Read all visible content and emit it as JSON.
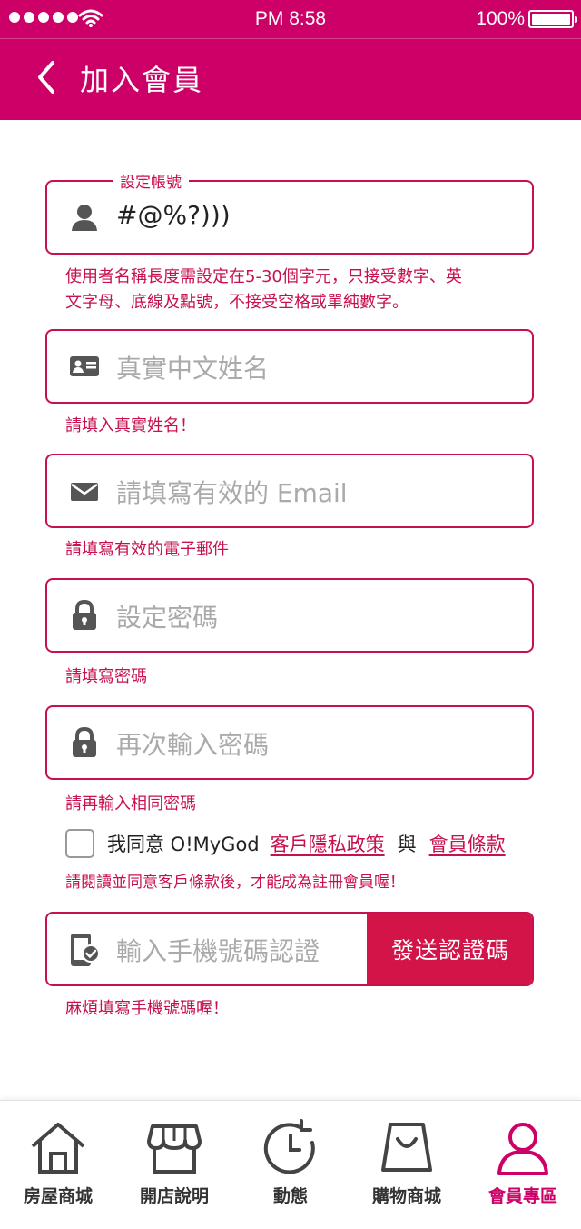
{
  "status_bar": {
    "time": "PM 8:58",
    "battery": "100%"
  },
  "header": {
    "title": "加入會員"
  },
  "form": {
    "account": {
      "legend": "設定帳號",
      "value": "#@%?)))",
      "hint_line1": "使用者名稱長度需設定在5-30個字元，只接受數字、英",
      "hint_line2": "文字母、底線及點號，不接受空格或單純數字。"
    },
    "name": {
      "placeholder": "真實中文姓名",
      "hint": "請填入真實姓名！"
    },
    "email": {
      "placeholder": "請填寫有效的 Email",
      "hint": "請填寫有效的電子郵件"
    },
    "password": {
      "placeholder": "設定密碼",
      "hint": "請填寫密碼"
    },
    "password_confirm": {
      "placeholder": "再次輸入密碼",
      "hint": "請再輸入相同密碼"
    },
    "agree": {
      "prefix": "我同意 O!MyGod",
      "privacy_link": "客戶隱私政策",
      "and": "與",
      "terms_link": "會員條款",
      "hint": "請閱讀並同意客戶條款後，才能成為註冊會員喔！"
    },
    "phone": {
      "placeholder": "輸入手機號碼認證",
      "send_button": "發送認證碼",
      "hint": "麻煩填寫手機號碼喔！"
    }
  },
  "tabs": [
    {
      "label": "房屋商城",
      "icon": "house-icon"
    },
    {
      "label": "開店說明",
      "icon": "shop-icon"
    },
    {
      "label": "動態",
      "icon": "timeline-icon"
    },
    {
      "label": "購物商城",
      "icon": "shopping-bag-icon"
    },
    {
      "label": "會員專區",
      "icon": "member-icon",
      "active": true
    }
  ],
  "colors": {
    "primary": "#cc0066",
    "error": "#c8104f",
    "button": "#d21449"
  }
}
